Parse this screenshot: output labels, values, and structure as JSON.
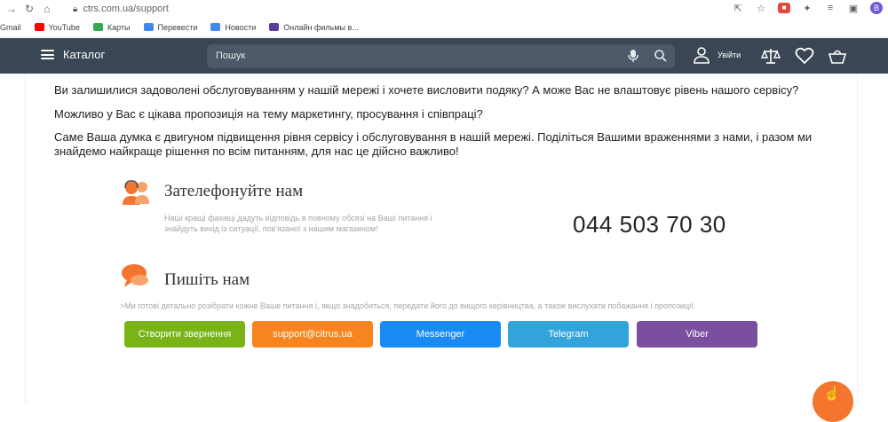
{
  "browser": {
    "url": "ctrs.com.ua/support",
    "profile_initial": "B",
    "bookmarks": [
      {
        "label": "Gmail",
        "color": "#ea4335"
      },
      {
        "label": "YouTube",
        "color": "#ff0000"
      },
      {
        "label": "Карты",
        "color": "#34a853"
      },
      {
        "label": "Перевести",
        "color": "#4285f4"
      },
      {
        "label": "Новости",
        "color": "#4285f4"
      },
      {
        "label": "Онлайн фильмы в...",
        "color": "#5b3d99"
      }
    ]
  },
  "header": {
    "catalog_label": "Каталог",
    "search_placeholder": "Пошук",
    "login_label": "Увійти"
  },
  "content": {
    "paragraphs": [
      "Ви залишилися задоволені обслуговуванням у нашій мережі і хочете висловити подяку? А може Вас не влаштовує рівень нашого сервісу?",
      "Можливо у Вас є цікава пропозиція на тему маркетингу, просування і співпраці?",
      "Саме Ваша думка є двигуном підвищення рівня сервісу і обслуговування в нашій мережі. Поділіться Вашими враженнями з нами, і разом ми знайдемо найкраще рішення по всім питанням, для нас це дійсно важливо!"
    ],
    "call": {
      "title": "Зателефонуйте нам",
      "description": "Наші кращі фахівці дадуть відповідь в повному обсязі на Ваші питання і знайдуть вихід із ситуації, пов'язаної з нашим магазином!",
      "phone": "044 503 70 30"
    },
    "write": {
      "title": "Пишіть нам",
      "description": ">Ми готові детально розібрати кожне Ваше питання і, якщо знадобиться, передати його до вищого керівництва, а також вислухати побажання і пропозиції."
    },
    "buttons": [
      {
        "label": "Створити звернення",
        "color": "#7ab317"
      },
      {
        "label": "support@citrus.ua",
        "color": "#f7851f"
      },
      {
        "label": "Messenger",
        "color": "#1a8af5"
      },
      {
        "label": "Telegram",
        "color": "#33a3dc"
      },
      {
        "label": "Viber",
        "color": "#7b4fa0"
      }
    ]
  },
  "colors": {
    "accent_orange": "#f4752e",
    "header_bg": "#3a4654"
  }
}
